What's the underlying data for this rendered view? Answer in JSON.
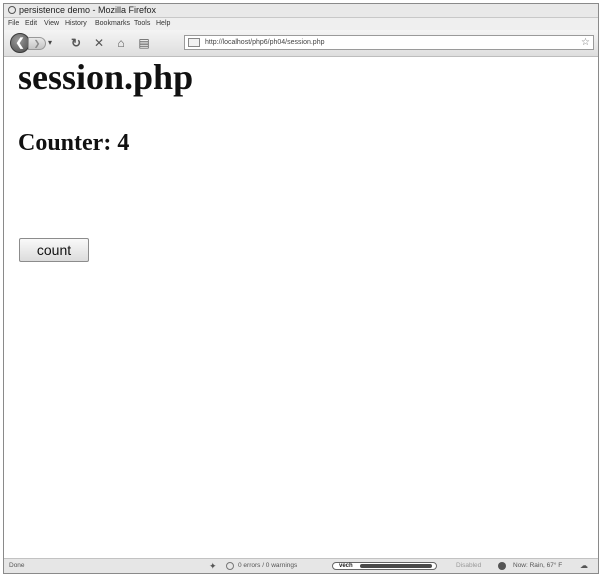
{
  "window": {
    "title": "persistence demo - Mozilla Firefox"
  },
  "menu": [
    "File",
    "Edit",
    "View",
    "History",
    "Bookmarks",
    "Tools",
    "Help"
  ],
  "navbar": {
    "url": "http://localhost/php6/ph04/session.php"
  },
  "page": {
    "title": "session.php",
    "counter": "Counter: 4",
    "button_label": "count"
  },
  "status": {
    "left": "Done",
    "errors": "0 errors / 0 warnings",
    "vech": "vech",
    "disabled": "Disabled",
    "weather": "Now: Rain, 67° F"
  }
}
